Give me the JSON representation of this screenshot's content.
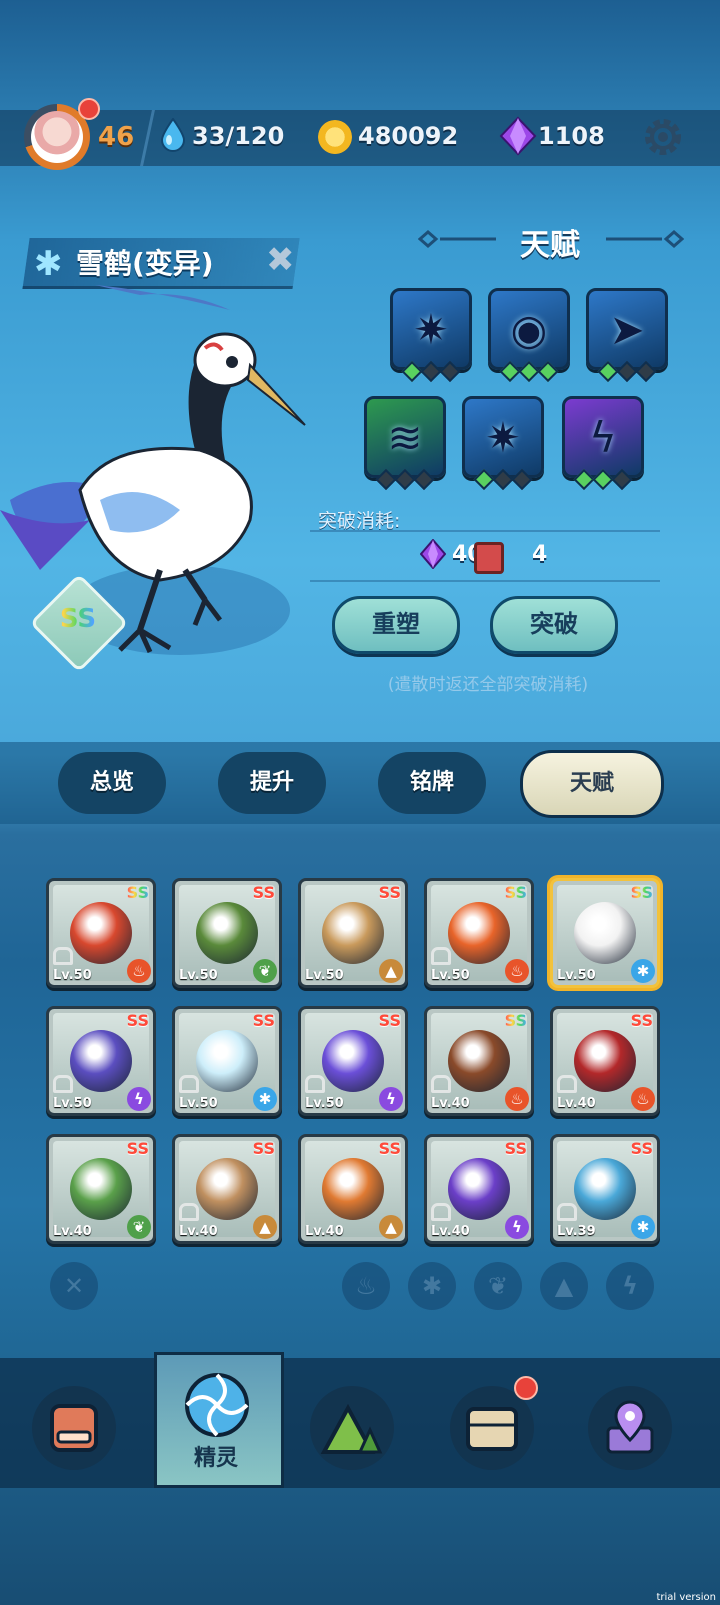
{
  "topbar": {
    "player_level": "46",
    "stamina": "33/120",
    "coins": "480092",
    "gems": "1108",
    "icons": [
      "avatar",
      "water-drop-icon",
      "coin-icon",
      "gem-icon",
      "gear-icon"
    ]
  },
  "pet": {
    "name": "雪鹤(变异)",
    "rarity": "SS"
  },
  "talent": {
    "title": "天赋",
    "skills": [
      {
        "icon": "ice-burst-icon",
        "color": "#2e78c8",
        "filled": 1
      },
      {
        "icon": "eye-icon",
        "color": "#2e78c8",
        "filled": 3
      },
      {
        "icon": "dive-icon",
        "color": "#2e78c8",
        "filled": 1
      },
      {
        "icon": "claw-icon",
        "color": "#2e9a4f",
        "filled": 0
      },
      {
        "icon": "ice-burst-icon",
        "color": "#2e78c8",
        "filled": 1
      },
      {
        "icon": "lightning-icon",
        "color": "#7c3bd0",
        "filled": 2
      }
    ],
    "cost_label": "突破消耗:",
    "cost_gems": "40",
    "cost_cards": "4",
    "reshape_label": "重塑",
    "breakthrough_label": "突破",
    "note": "(遣散时返还全部突破消耗)"
  },
  "tabs": [
    "总览",
    "提升",
    "铭牌",
    "天赋"
  ],
  "active_tab": "天赋",
  "roster": [
    {
      "rarity": "SS",
      "rainbow": true,
      "level": "Lv.50",
      "element": "fire",
      "locked": true,
      "color": "#d8482e"
    },
    {
      "rarity": "SS",
      "rainbow": false,
      "level": "Lv.50",
      "element": "grass",
      "locked": false,
      "color": "#5a8a3a"
    },
    {
      "rarity": "SS",
      "rainbow": false,
      "level": "Lv.50",
      "element": "earth",
      "locked": false,
      "color": "#c99a5c"
    },
    {
      "rarity": "SS",
      "rainbow": true,
      "level": "Lv.50",
      "element": "fire",
      "locked": true,
      "color": "#e8642a"
    },
    {
      "rarity": "SS",
      "rainbow": true,
      "level": "Lv.50",
      "element": "ice",
      "locked": false,
      "color": "#f2f2f2",
      "selected": true
    },
    {
      "rarity": "SS",
      "rainbow": false,
      "level": "Lv.50",
      "element": "thunder",
      "locked": true,
      "color": "#5b4ec0"
    },
    {
      "rarity": "SS",
      "rainbow": false,
      "level": "Lv.50",
      "element": "ice",
      "locked": true,
      "color": "#cdeefa"
    },
    {
      "rarity": "SS",
      "rainbow": false,
      "level": "Lv.50",
      "element": "thunder",
      "locked": true,
      "color": "#6b4fd8"
    },
    {
      "rarity": "SS",
      "rainbow": true,
      "level": "Lv.40",
      "element": "fire",
      "locked": true,
      "color": "#8a4a2a"
    },
    {
      "rarity": "SS",
      "rainbow": false,
      "level": "Lv.40",
      "element": "fire",
      "locked": true,
      "color": "#b3282a"
    },
    {
      "rarity": "SS",
      "rainbow": false,
      "level": "Lv.40",
      "element": "grass",
      "locked": false,
      "color": "#5aa04a"
    },
    {
      "rarity": "SS",
      "rainbow": false,
      "level": "Lv.40",
      "element": "earth",
      "locked": true,
      "color": "#c09060"
    },
    {
      "rarity": "SS",
      "rainbow": false,
      "level": "Lv.40",
      "element": "earth",
      "locked": false,
      "color": "#e07a32"
    },
    {
      "rarity": "SS",
      "rainbow": false,
      "level": "Lv.40",
      "element": "thunder",
      "locked": true,
      "color": "#6b3fc8"
    },
    {
      "rarity": "SS",
      "rainbow": false,
      "level": "Lv.39",
      "element": "ice",
      "locked": true,
      "color": "#4aa8d8"
    }
  ],
  "filters": [
    "close-icon",
    "fire-icon",
    "ice-icon",
    "grass-icon",
    "earth-icon",
    "thunder-icon"
  ],
  "nav": {
    "items": [
      "shop-icon",
      "spirit-icon",
      "map-mountain-icon",
      "chest-icon",
      "location-icon"
    ],
    "active_label": "精灵"
  },
  "watermark": "trial version"
}
